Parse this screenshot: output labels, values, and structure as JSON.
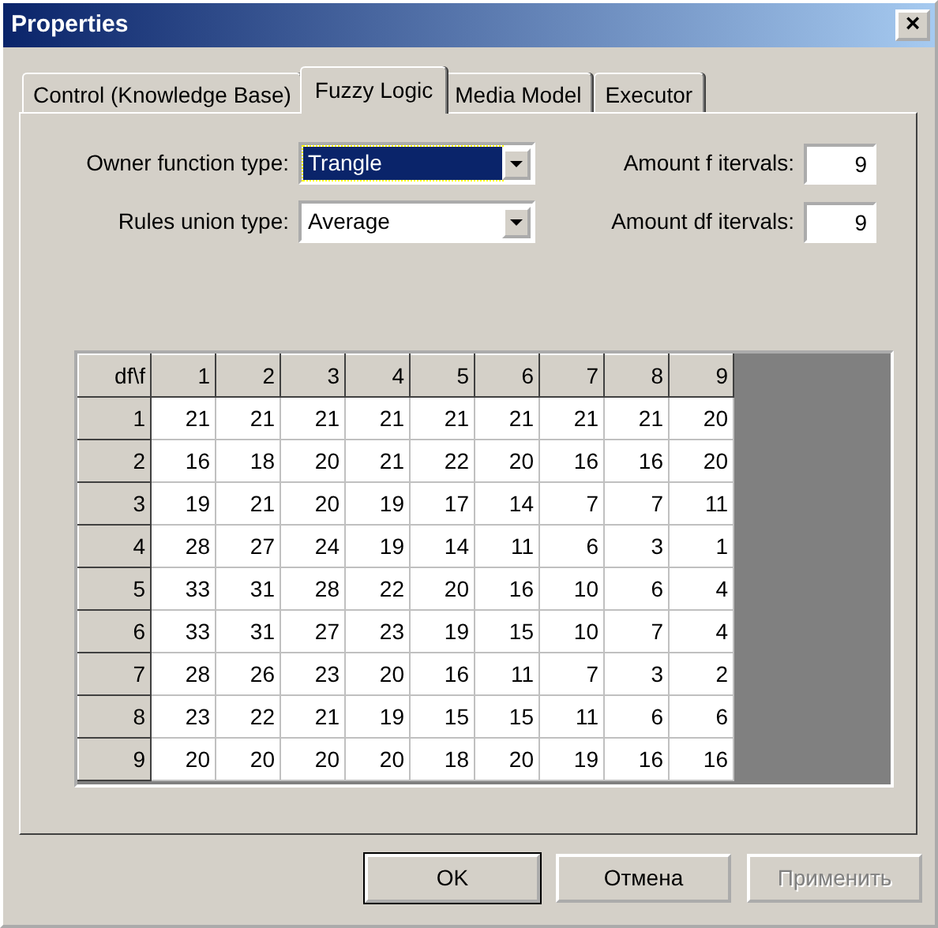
{
  "window": {
    "title": "Properties",
    "close": "×"
  },
  "tabs": [
    {
      "label": "Control (Knowledge Base)",
      "selected": false
    },
    {
      "label": "Fuzzy Logic",
      "selected": true
    },
    {
      "label": "Media Model",
      "selected": false
    },
    {
      "label": "Executor",
      "selected": false
    }
  ],
  "fields": [
    {
      "kind": "combo",
      "label": "Owner function type:",
      "value": "Trangle",
      "focused": true
    },
    {
      "kind": "number",
      "label": "Amount f itervals:",
      "value": "9"
    },
    {
      "kind": "combo",
      "label": "Rules union type:",
      "value": "Average",
      "focused": false
    },
    {
      "kind": "number",
      "label": "Amount df itervals:",
      "value": "9"
    }
  ],
  "table": {
    "corner": "df\\f",
    "columns": [
      "1",
      "2",
      "3",
      "4",
      "5",
      "6",
      "7",
      "8",
      "9"
    ],
    "rows": [
      {
        "label": "1",
        "cells": [
          "21",
          "21",
          "21",
          "21",
          "21",
          "21",
          "21",
          "21",
          "20"
        ]
      },
      {
        "label": "2",
        "cells": [
          "16",
          "18",
          "20",
          "21",
          "22",
          "20",
          "16",
          "16",
          "20"
        ]
      },
      {
        "label": "3",
        "cells": [
          "19",
          "21",
          "20",
          "19",
          "17",
          "14",
          "7",
          "7",
          "11"
        ]
      },
      {
        "label": "4",
        "cells": [
          "28",
          "27",
          "24",
          "19",
          "14",
          "11",
          "6",
          "3",
          "1"
        ]
      },
      {
        "label": "5",
        "cells": [
          "33",
          "31",
          "28",
          "22",
          "20",
          "16",
          "10",
          "6",
          "4"
        ]
      },
      {
        "label": "6",
        "cells": [
          "33",
          "31",
          "27",
          "23",
          "19",
          "15",
          "10",
          "7",
          "4"
        ]
      },
      {
        "label": "7",
        "cells": [
          "28",
          "26",
          "23",
          "20",
          "16",
          "11",
          "7",
          "3",
          "2"
        ]
      },
      {
        "label": "8",
        "cells": [
          "23",
          "22",
          "21",
          "19",
          "15",
          "15",
          "11",
          "6",
          "6"
        ]
      },
      {
        "label": "9",
        "cells": [
          "20",
          "20",
          "20",
          "20",
          "18",
          "20",
          "19",
          "16",
          "16"
        ]
      }
    ]
  },
  "buttons": [
    {
      "label": "OK",
      "disabled": false,
      "default": true
    },
    {
      "label": "Отмена",
      "disabled": false,
      "default": false
    },
    {
      "label": "Применить",
      "disabled": true,
      "default": false
    }
  ]
}
